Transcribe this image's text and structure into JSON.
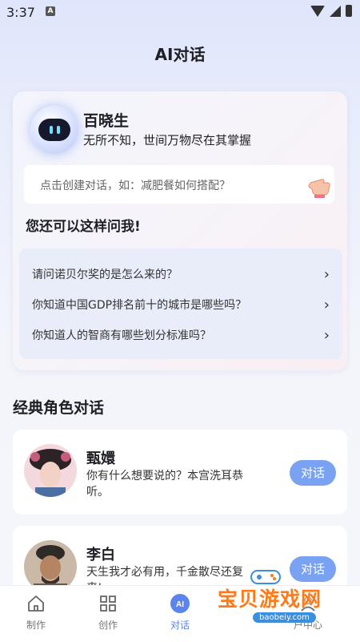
{
  "status": {
    "time": "3:37",
    "app_icon": "A"
  },
  "header": {
    "title": "AI对话"
  },
  "bot": {
    "name": "百晓生",
    "tagline": "无所不知，世间万物尽在其掌握",
    "prompt_placeholder": "点击创建对话，如：减肥餐如何搭配？"
  },
  "suggestions": {
    "title": "您还可以这样问我!",
    "items": [
      {
        "text": "请问诺贝尔奖的是怎么来的？"
      },
      {
        "text": "你知道中国GDP排名前十的城市是哪些吗？"
      },
      {
        "text": "你知道人的智商有哪些划分标准吗？"
      }
    ]
  },
  "classic": {
    "title": "经典角色对话",
    "roles": [
      {
        "name": "甄嬛",
        "desc": "你有什么想要说的？本宫洗耳恭听。",
        "button": "对话"
      },
      {
        "name": "李白",
        "desc": "天生我才必有用，千金散尽还复来!",
        "button": "对话"
      }
    ]
  },
  "tabs": [
    {
      "label": "制作",
      "icon": "home-icon"
    },
    {
      "label": "创作",
      "icon": "grid-icon"
    },
    {
      "label": "对话",
      "icon": "ai-chat-icon"
    },
    {
      "label": "户中心",
      "icon": "user-icon"
    }
  ],
  "watermark": {
    "text": "宝贝游戏网",
    "url": "baobeiy.com"
  },
  "colors": {
    "accent": "#5b85ec",
    "button": "#7aa2f3"
  }
}
